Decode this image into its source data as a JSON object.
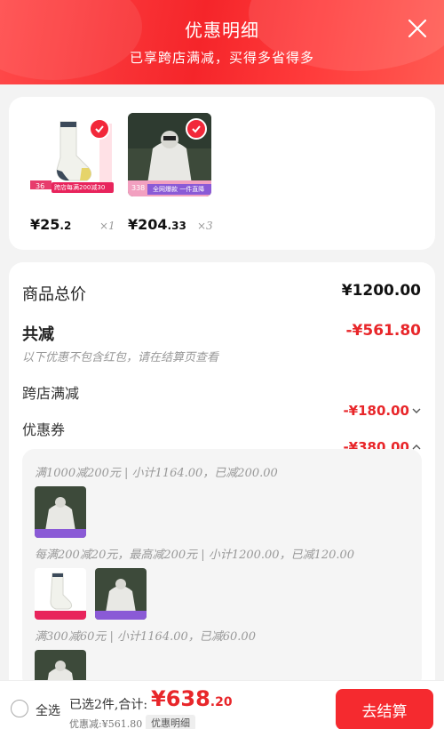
{
  "header": {
    "title": "优惠明细",
    "subtitle": "已享跨店满减，买得多省得多"
  },
  "products": [
    {
      "price_main": "¥25",
      "price_decimal": ".2",
      "qty": "×1",
      "image": "socks-product"
    },
    {
      "price_main": "¥204",
      "price_decimal": ".33",
      "qty": "×3",
      "image": "jacket-product"
    }
  ],
  "product_badges": {
    "p1_left": "36",
    "p1_banner": "跨店每满200减30",
    "p2_left": "338",
    "p2_banner": "全网爆款 一件直降"
  },
  "summary": {
    "total_label": "商品总价",
    "total_value": "¥1200.00",
    "reduce_label": "共减",
    "reduce_value": "-¥561.80",
    "note": "以下优惠不包含红包，请在结算页查看",
    "cross_store_label": "跨店满减",
    "cross_store_value": "-¥180.00",
    "coupon_label": "优惠券",
    "coupon_value": "-¥380.00"
  },
  "coupons": [
    {
      "text": "满1000减200元 | 小计1164.00，已减200.00"
    },
    {
      "text": "每满200减20元，最高减200元 | 小计1200.00，已减120.00"
    },
    {
      "text": "满300减60元 | 小计1164.00，已减60.00"
    }
  ],
  "footer": {
    "select_all": "全选",
    "selected_text": "已选2件,合计:",
    "total_main": "¥638",
    "total_decimal": ".20",
    "discount_text": "优惠减:¥561.80",
    "detail_tag": "优惠明细",
    "checkout": "去结算"
  },
  "colors": {
    "accent": "#f5252a",
    "price_red": "#e8262a"
  }
}
